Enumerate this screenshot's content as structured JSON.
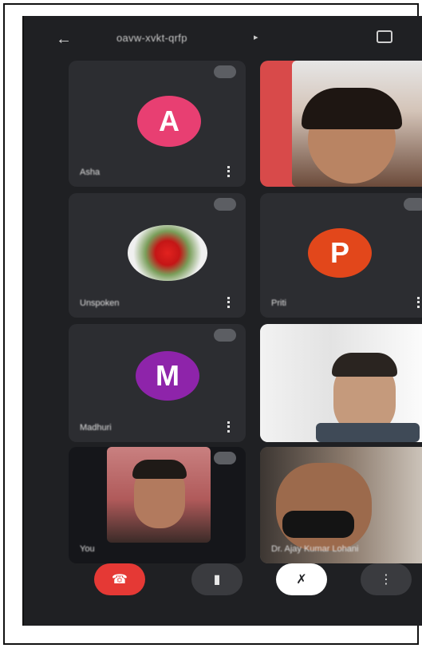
{
  "header": {
    "back_icon": "arrow-left-icon",
    "meeting_code": "oavw-xvkt-qrfp",
    "switch_camera_icon": "camera-switch-icon"
  },
  "tiles": [
    {
      "name": "Asha",
      "avatar_letter": "A",
      "avatar_color": "#e83f72"
    },
    {
      "name": "",
      "type": "video"
    },
    {
      "name": "Unspoken",
      "avatar_type": "rose-image"
    },
    {
      "name": "Priti",
      "avatar_letter": "P",
      "avatar_color": "#e2471b"
    },
    {
      "name": "Madhuri",
      "avatar_letter": "M",
      "avatar_color": "#8e24aa"
    },
    {
      "name": "",
      "type": "video"
    },
    {
      "name": "You",
      "type": "self-video"
    },
    {
      "name": "Dr. Ajay Kumar Lohani",
      "type": "video"
    }
  ],
  "controls": {
    "end_call_icon": "phone-hangup-icon",
    "end_call_color": "#e53935",
    "camera_icon": "camera-icon",
    "mic_icon": "mic-icon",
    "more_icon": "more-vertical-icon"
  }
}
